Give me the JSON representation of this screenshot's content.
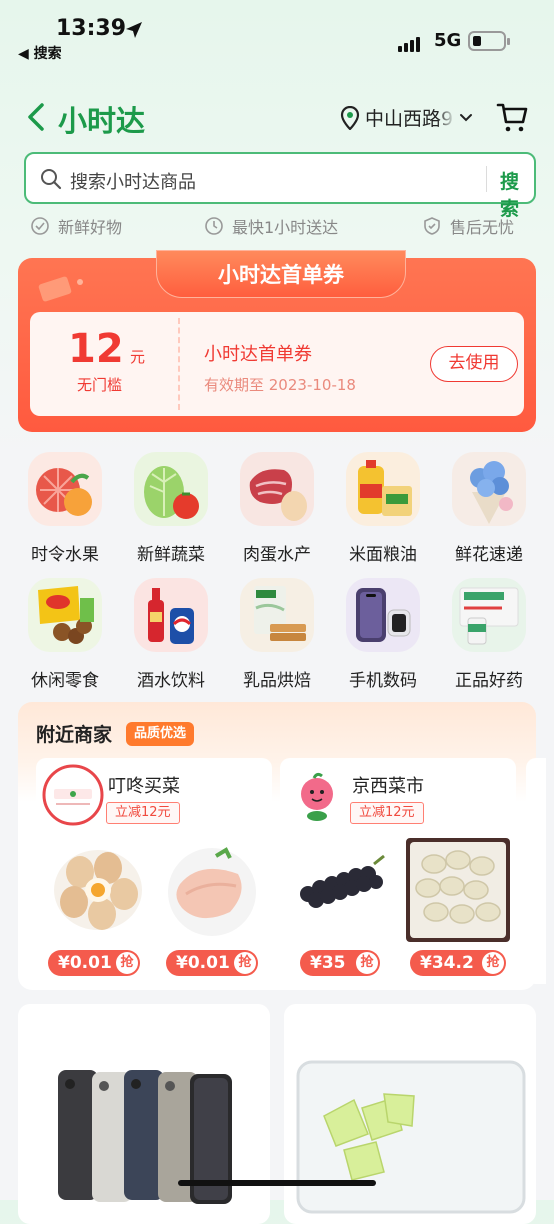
{
  "status_bar": {
    "time": "13:39",
    "back_app": "◀ 搜索",
    "network": "5G"
  },
  "header": {
    "title": "小时达",
    "address": "中山西路9",
    "back_icon": "chevron-left-icon",
    "cart_icon": "cart-icon"
  },
  "search": {
    "placeholder": "搜索小时达商品",
    "button": "搜索"
  },
  "features": [
    {
      "label": "新鲜好物",
      "icon": "check-circle-icon"
    },
    {
      "label": "最快1小时送达",
      "icon": "clock-icon"
    },
    {
      "label": "售后无忧",
      "icon": "shield-check-icon"
    }
  ],
  "coupon": {
    "banner_title": "小时达首单券",
    "amount": "12",
    "unit": "元",
    "condition": "无门槛",
    "name": "小时达首单券",
    "validity": "有效期至 2023-10-18",
    "button": "去使用"
  },
  "categories": [
    {
      "label": "时令水果"
    },
    {
      "label": "新鲜蔬菜"
    },
    {
      "label": "肉蛋水产"
    },
    {
      "label": "米面粮油"
    },
    {
      "label": "鲜花速递"
    },
    {
      "label": "休闲零食"
    },
    {
      "label": "酒水饮料"
    },
    {
      "label": "乳品烘焙"
    },
    {
      "label": "手机数码"
    },
    {
      "label": "正品好药"
    }
  ],
  "nearby": {
    "title": "附近商家",
    "badge": "品质优选",
    "shops": [
      {
        "name": "叮咚买菜",
        "promo": "立减12元",
        "products": [
          {
            "price": "¥0.01",
            "tag": "抢"
          },
          {
            "price": "¥0.01",
            "tag": "抢"
          }
        ]
      },
      {
        "name": "京西菜市",
        "promo": "立减12元",
        "products": [
          {
            "price": "¥35",
            "tag": "抢"
          },
          {
            "price": "¥34.2",
            "tag": "抢"
          }
        ]
      }
    ]
  },
  "colors": {
    "brand_green": "#1c9a4a",
    "coupon_red": "#f03a33",
    "price_red": "#f45b4d",
    "badge_orange": "#ff7a2d"
  }
}
